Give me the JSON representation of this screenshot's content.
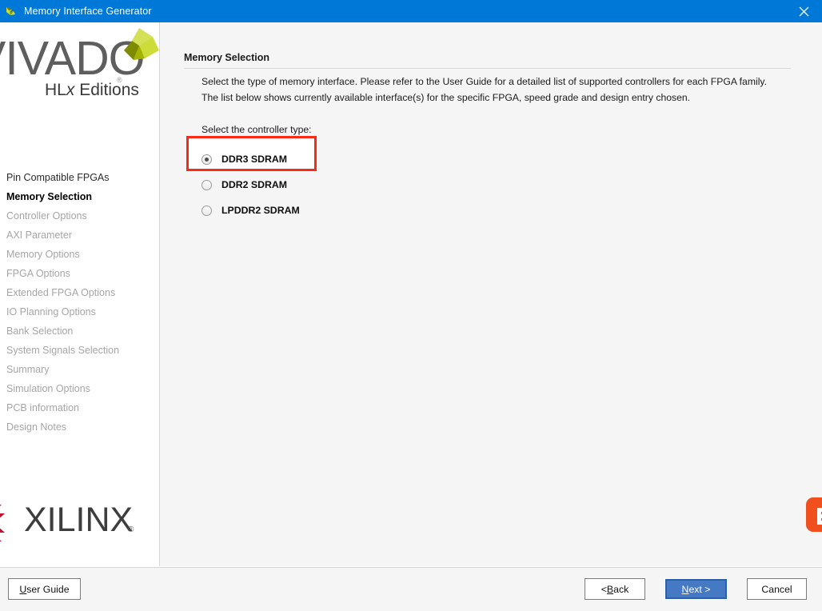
{
  "window": {
    "title": "Memory Interface Generator",
    "app_icon": "vivado-bird-icon",
    "close_icon": "close-icon",
    "titlebar_color": "#0078d7"
  },
  "sidebar": {
    "logo": {
      "wordmark": "VIVADO",
      "registered": "®",
      "subtitle_pre": "HL",
      "subtitle_italic": "x",
      "subtitle_post": " Editions",
      "mark_icon": "vivado-pinwheel-icon"
    },
    "nav_items": [
      {
        "label": "Pin Compatible FPGAs",
        "state": "done"
      },
      {
        "label": "Memory Selection",
        "state": "current"
      },
      {
        "label": "Controller Options",
        "state": "disabled"
      },
      {
        "label": "AXI Parameter",
        "state": "disabled"
      },
      {
        "label": "Memory Options",
        "state": "disabled"
      },
      {
        "label": "FPGA Options",
        "state": "disabled"
      },
      {
        "label": "Extended FPGA Options",
        "state": "disabled"
      },
      {
        "label": "IO Planning Options",
        "state": "disabled"
      },
      {
        "label": "Bank Selection",
        "state": "disabled"
      },
      {
        "label": "System Signals Selection",
        "state": "disabled"
      },
      {
        "label": "Summary",
        "state": "disabled"
      },
      {
        "label": "Simulation Options",
        "state": "disabled"
      },
      {
        "label": "PCB information",
        "state": "disabled"
      },
      {
        "label": "Design Notes",
        "state": "disabled"
      }
    ],
    "vendor_logo": {
      "wordmark": "XILINX",
      "registered": "®",
      "mark_icon": "xilinx-x-icon",
      "mark_color": "#c8102e"
    }
  },
  "main": {
    "page_title": "Memory Selection",
    "description_line1": "Select the type of memory interface. Please refer to the User Guide for a detailed list of supported controllers for each FPGA family.",
    "description_line2": "The list below shows currently available interface(s) for the specific FPGA, speed grade and design entry chosen.",
    "group_label": "Select the controller type:",
    "controller_options": [
      {
        "label": "DDR3 SDRAM",
        "selected": true
      },
      {
        "label": "DDR2 SDRAM",
        "selected": false
      },
      {
        "label": "LPDDR2 SDRAM",
        "selected": false
      }
    ],
    "annotation": {
      "type": "highlight-rectangle",
      "color": "#fa2a18",
      "targets": "DDR3 SDRAM"
    },
    "corner_badge_icon": "orange-rounded-badge-icon"
  },
  "footer": {
    "user_guide": {
      "pre": "",
      "accel": "U",
      "post": "ser Guide"
    },
    "back": {
      "pre": "< ",
      "accel": "B",
      "post": "ack"
    },
    "next": {
      "pre": "",
      "accel": "N",
      "post": "ext >",
      "primary": true,
      "color": "#4679c4"
    },
    "cancel": {
      "pre": "Cancel",
      "accel": "",
      "post": ""
    }
  }
}
